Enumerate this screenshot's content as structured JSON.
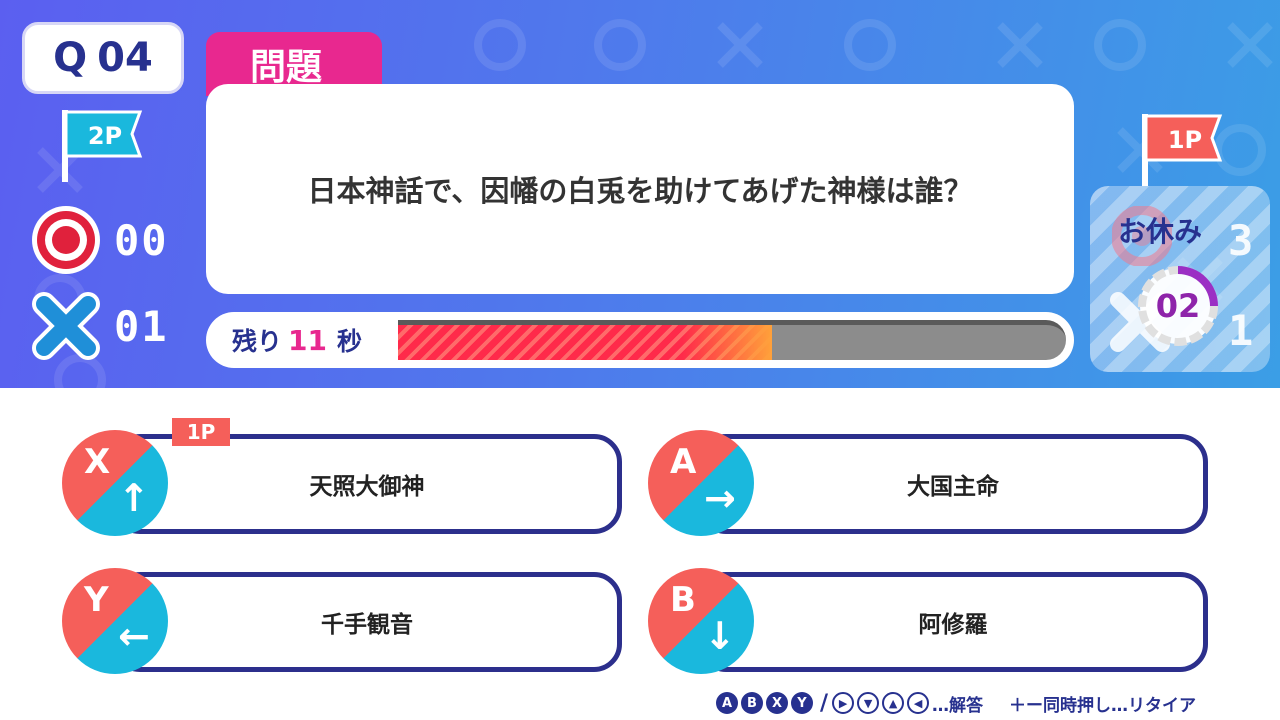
{
  "question_badge": {
    "label": "Q",
    "number": "04"
  },
  "player2": {
    "flag_label": "2P",
    "correct_count": "00",
    "wrong_count": "01"
  },
  "player1": {
    "flag_label": "1P",
    "status": "お休み",
    "rest_turns": "02",
    "ghost_correct": "3",
    "ghost_wrong": "1"
  },
  "question": {
    "tab_label": "問題",
    "text": "日本神話で、因幡の白兎を助けてあげた神様は誰？"
  },
  "timer": {
    "prefix": "残り",
    "seconds": "11",
    "suffix": "秒",
    "remaining_fraction": 0.56
  },
  "answers": [
    {
      "key": "X",
      "arrow": "↑",
      "text": "天照大御神",
      "selected_by": "1P"
    },
    {
      "key": "A",
      "arrow": "→",
      "text": "大国主命"
    },
    {
      "key": "Y",
      "arrow": "←",
      "text": "千手観音"
    },
    {
      "key": "B",
      "arrow": "↓",
      "text": "阿修羅"
    }
  ],
  "controls": {
    "answer_buttons": [
      "A",
      "B",
      "X",
      "Y"
    ],
    "separator": "/",
    "dpad_buttons": [
      "▶",
      "▼",
      "▲",
      "◀"
    ],
    "answer_hint": "…解答",
    "retire_hint": "＋ー同時押し…リタイア"
  },
  "colors": {
    "accent_pink": "#e8288f",
    "navy": "#27318f",
    "key_red": "#f55f5a",
    "key_cyan": "#1ab8dd",
    "purple": "#8e24aa"
  }
}
